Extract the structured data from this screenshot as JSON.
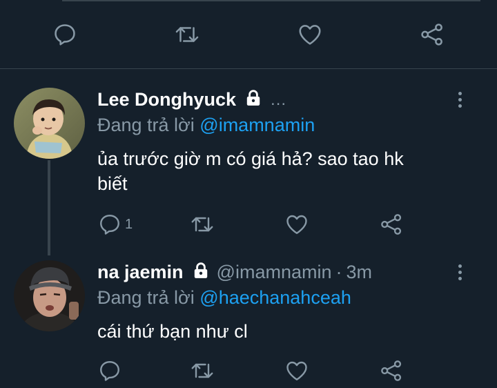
{
  "colors": {
    "background": "#15202b",
    "text": "#ffffff",
    "muted": "#8899a6",
    "link": "#1da1f2",
    "divider": "#38444d"
  },
  "top_actions": {
    "reply": "reply-icon",
    "retweet": "retweet-icon",
    "like": "heart-icon",
    "share": "share-icon"
  },
  "tweets": [
    {
      "name": "Lee Donghyuck",
      "handle": "",
      "ellipsis": "...",
      "reply_prefix": "Đang trả lời",
      "reply_to": "@imamnamin",
      "text_line1": "ủa trước giờ m có giá hả? sao tao hk",
      "text_line2": "biết",
      "reply_count": "1"
    },
    {
      "name": "na jaemin",
      "handle": "@imamnamin",
      "separator": "·",
      "time": "3m",
      "reply_prefix": "Đang trả lời",
      "reply_to": "@haechanahceah",
      "text_line1": "cái thứ bạn như cl"
    }
  ]
}
